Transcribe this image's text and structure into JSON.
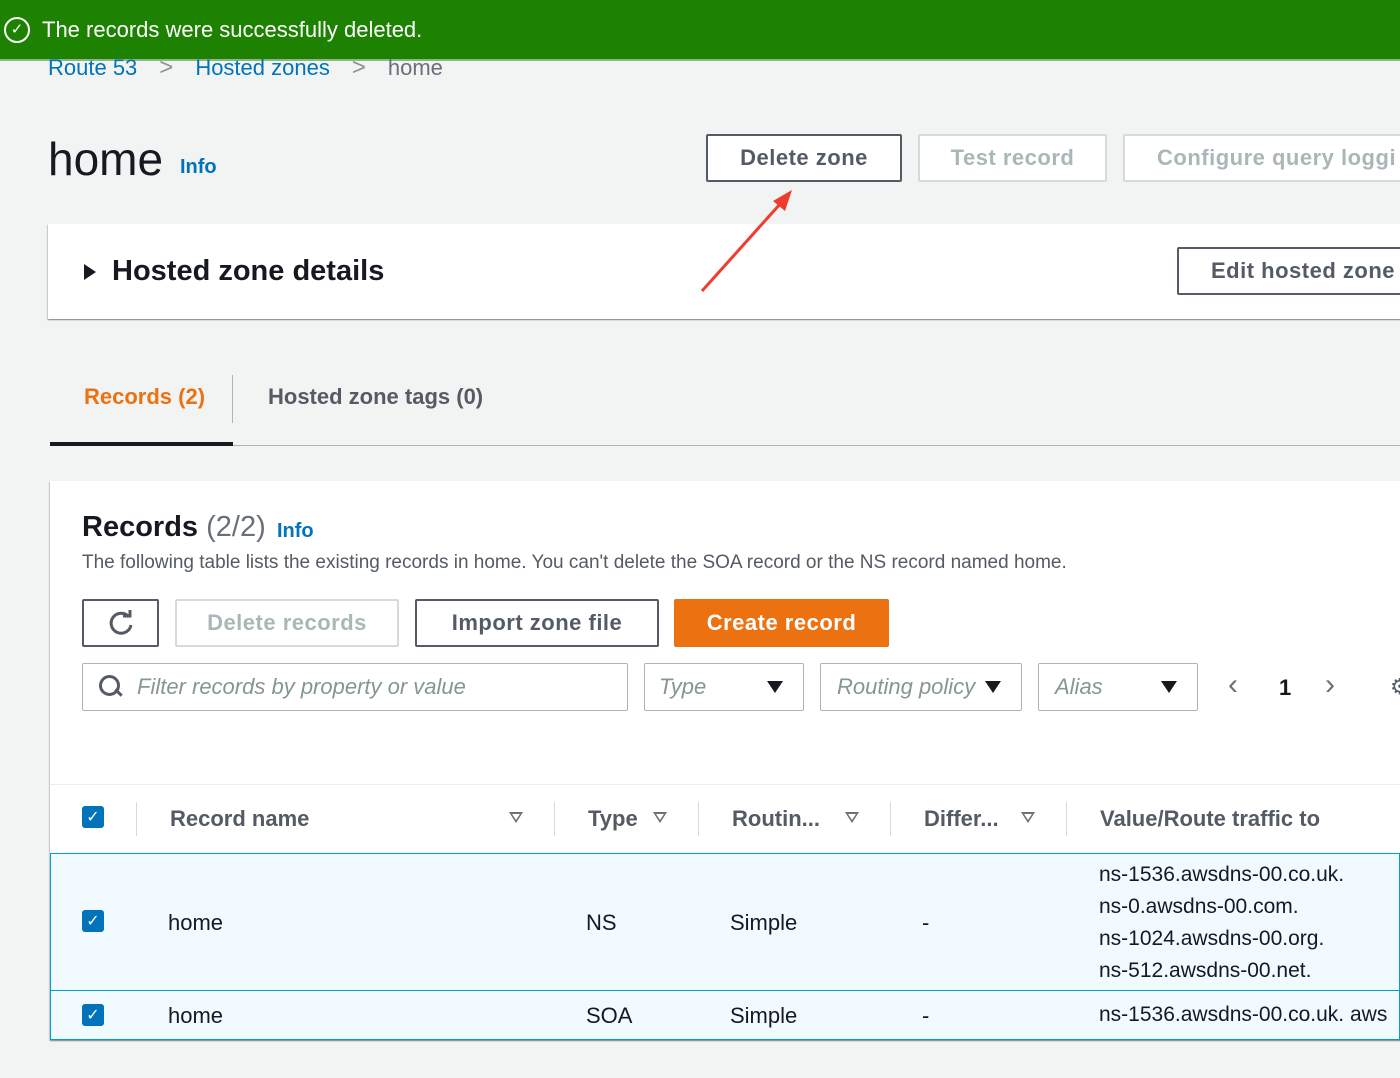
{
  "notification": {
    "message": "The records were successfully deleted."
  },
  "breadcrumb": {
    "items": [
      "Route 53",
      "Hosted zones",
      "home"
    ]
  },
  "page": {
    "title": "home",
    "info_label": "Info"
  },
  "header_actions": {
    "delete_zone": "Delete zone",
    "test_record": "Test record",
    "configure_query_logging": "Configure query loggi"
  },
  "details_panel": {
    "title": "Hosted zone details",
    "edit_button": "Edit hosted zone"
  },
  "tabs": [
    {
      "label": "Records (2)",
      "active": true
    },
    {
      "label": "Hosted zone tags (0)",
      "active": false
    }
  ],
  "records": {
    "heading": "Records",
    "count": "(2/2)",
    "info_label": "Info",
    "description": "The following table lists the existing records in home. You can't delete the SOA record or the NS record named home.",
    "buttons": {
      "delete": "Delete records",
      "import": "Import zone file",
      "create": "Create record"
    },
    "filters": {
      "search_placeholder": "Filter records by property or value",
      "type": "Type",
      "routing_policy": "Routing policy",
      "alias": "Alias"
    },
    "pagination": {
      "current_page": "1"
    },
    "columns": [
      "Record name",
      "Type",
      "Routin...",
      "Differ...",
      "Value/Route traffic to"
    ],
    "rows": [
      {
        "name": "home",
        "type": "NS",
        "routing": "Simple",
        "differ": "-",
        "values": [
          "ns-1536.awsdns-00.co.uk.",
          "ns-0.awsdns-00.com.",
          "ns-1024.awsdns-00.org.",
          "ns-512.awsdns-00.net."
        ]
      },
      {
        "name": "home",
        "type": "SOA",
        "routing": "Simple",
        "differ": "-",
        "values": [
          "ns-1536.awsdns-00.co.uk. aws"
        ]
      }
    ]
  },
  "colors": {
    "success": "#1d8102",
    "link": "#0073bb",
    "primary": "#ec7211",
    "annotation_arrow": "#f03c2e"
  }
}
